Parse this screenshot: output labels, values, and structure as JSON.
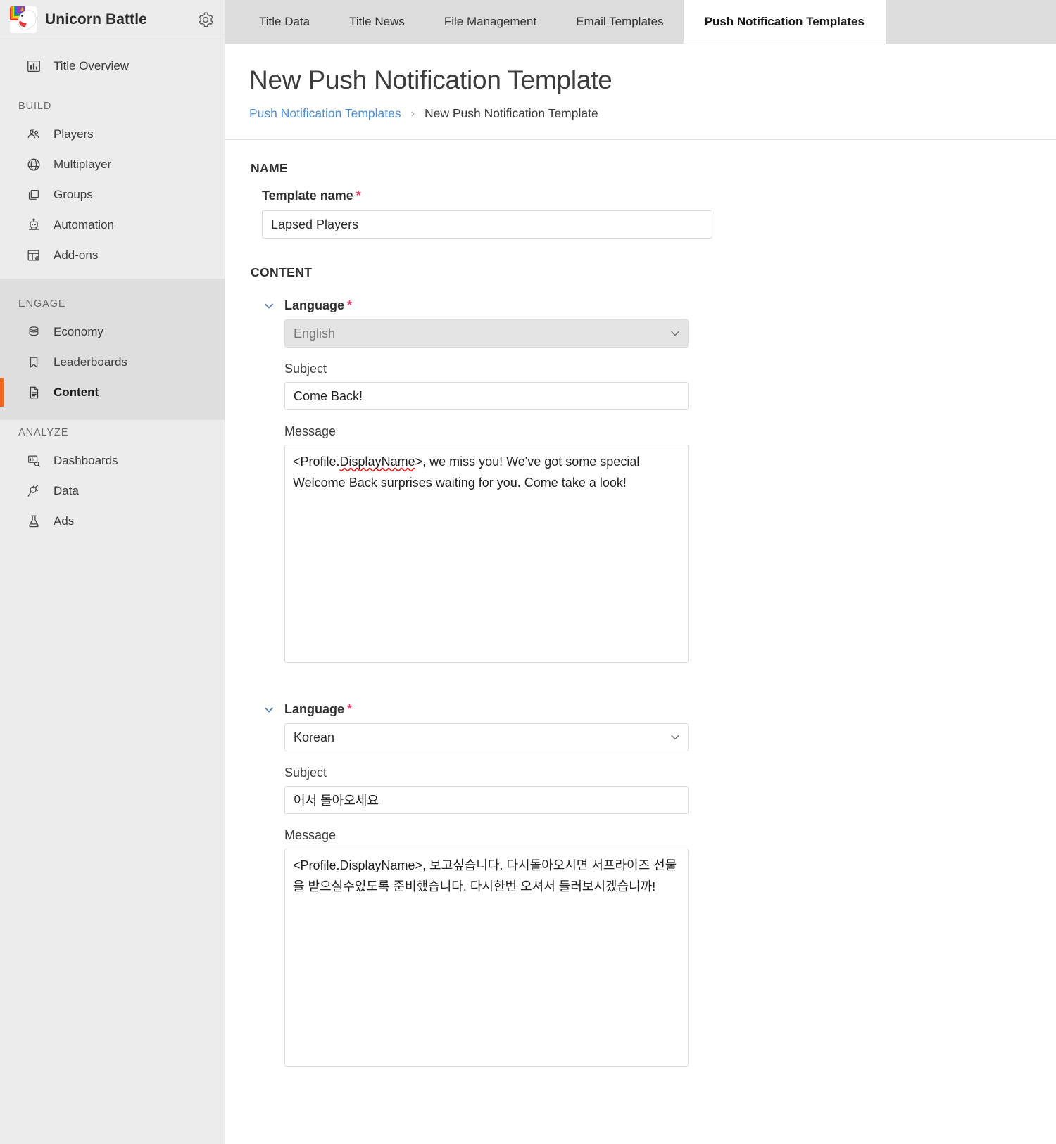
{
  "sidebar": {
    "brand": {
      "title": "Unicorn Battle",
      "logo_icon": "unicorn-logo",
      "gear_icon": "gear-icon"
    },
    "top_items": [
      {
        "label": "Title Overview",
        "icon": "bar-chart-icon"
      }
    ],
    "sections": [
      {
        "label": "BUILD",
        "items": [
          {
            "label": "Players",
            "icon": "players-icon"
          },
          {
            "label": "Multiplayer",
            "icon": "globe-icon"
          },
          {
            "label": "Groups",
            "icon": "groups-icon"
          },
          {
            "label": "Automation",
            "icon": "robot-icon"
          },
          {
            "label": "Add-ons",
            "icon": "addons-icon"
          }
        ]
      },
      {
        "label": "ENGAGE",
        "items": [
          {
            "label": "Economy",
            "icon": "coins-icon"
          },
          {
            "label": "Leaderboards",
            "icon": "bookmark-icon"
          },
          {
            "label": "Content",
            "icon": "document-icon",
            "active": true
          }
        ]
      },
      {
        "label": "ANALYZE",
        "items": [
          {
            "label": "Dashboards",
            "icon": "dashboards-icon"
          },
          {
            "label": "Data",
            "icon": "plug-icon"
          },
          {
            "label": "Ads",
            "icon": "flask-icon"
          }
        ]
      }
    ]
  },
  "tabs": [
    {
      "label": "Title Data",
      "active": false
    },
    {
      "label": "Title News",
      "active": false
    },
    {
      "label": "File Management",
      "active": false
    },
    {
      "label": "Email Templates",
      "active": false
    },
    {
      "label": "Push Notification Templates",
      "active": true
    }
  ],
  "header": {
    "title": "New Push Notification Template",
    "breadcrumb": {
      "link": "Push Notification Templates",
      "separator": "›",
      "current": "New Push Notification Template"
    }
  },
  "form": {
    "name_section": {
      "heading": "NAME",
      "template_name_label": "Template name",
      "required_marker": "*",
      "template_name_value": "Lapsed Players",
      "template_name_placeholder": ""
    },
    "content_section": {
      "heading": "CONTENT",
      "languages": [
        {
          "label": "Language",
          "required_marker": "*",
          "value": "English",
          "disabled": true,
          "subject_label": "Subject",
          "subject_value": "Come Back!",
          "message_label": "Message",
          "message_value": "<Profile.DisplayName>, we miss you! We've got some special Welcome Back surprises waiting for you. Come take a look!",
          "message_prefix": "<Profile.",
          "message_spell": "DisplayName",
          "message_rest": ">, we miss you! We've got some special Welcome Back surprises waiting for you. Come take a look!"
        },
        {
          "label": "Language",
          "required_marker": "*",
          "value": "Korean",
          "disabled": false,
          "subject_label": "Subject",
          "subject_value": "어서 돌아오세요",
          "message_label": "Message",
          "message_value": "<Profile.DisplayName>, 보고싶습니다. 다시돌아오시면 서프라이즈 선물을 받으실수있도록 준비했습니다. 다시한번 오셔서 들러보시겠습니까!"
        }
      ]
    }
  },
  "colors": {
    "accent_orange": "#f26722",
    "link_blue": "#4c8fd6",
    "required_pink": "#e8466e",
    "sidebar_bg": "#ececec",
    "sidebar_active_bg": "#dedede",
    "tabbar_bg": "#dcdcdc"
  }
}
